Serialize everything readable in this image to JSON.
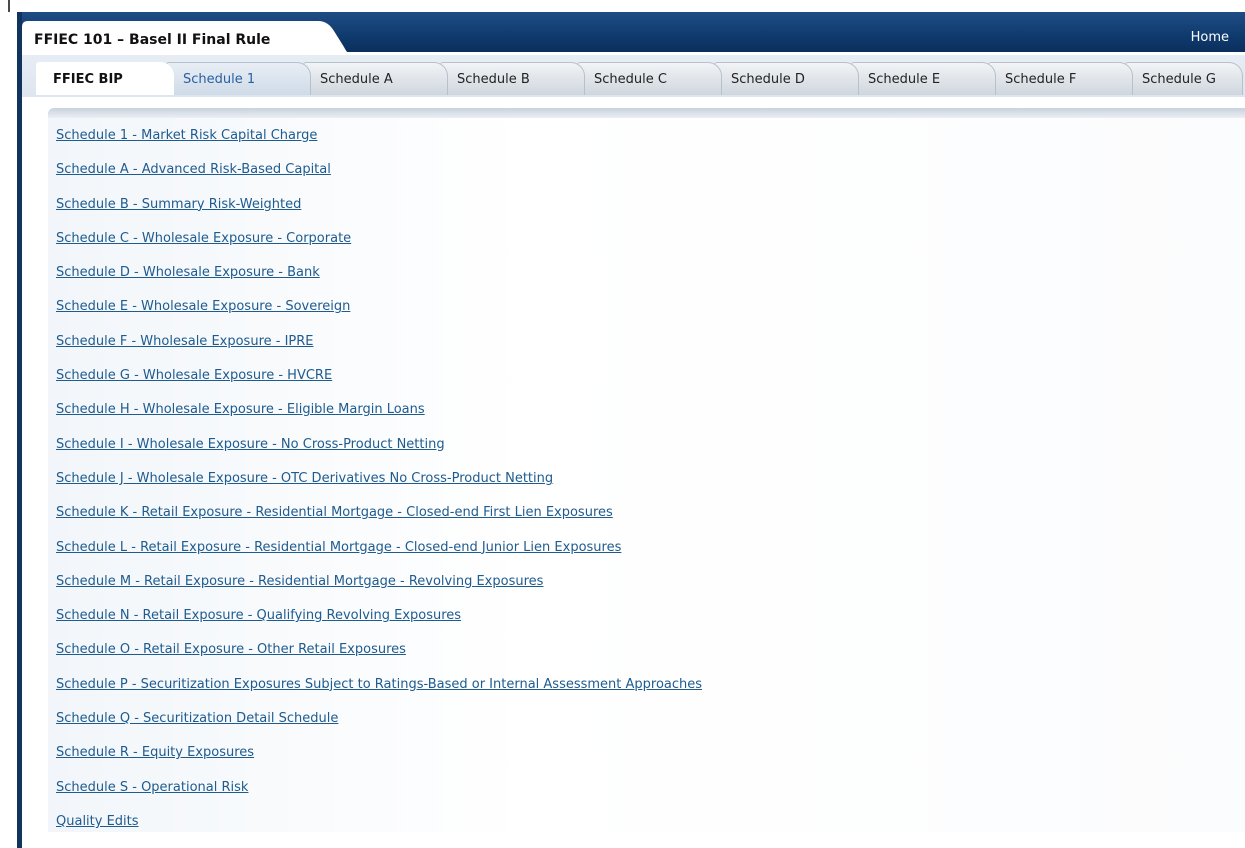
{
  "header": {
    "title": "FFIEC 101 – Basel II Final Rule",
    "home_label": "Home"
  },
  "tabs": [
    {
      "label": "FFIEC BIP",
      "state": "active"
    },
    {
      "label": "Schedule 1",
      "state": "link"
    },
    {
      "label": "Schedule A",
      "state": "normal"
    },
    {
      "label": "Schedule B",
      "state": "normal"
    },
    {
      "label": "Schedule C",
      "state": "normal"
    },
    {
      "label": "Schedule D",
      "state": "normal"
    },
    {
      "label": "Schedule E",
      "state": "normal"
    },
    {
      "label": "Schedule F",
      "state": "normal"
    },
    {
      "label": "Schedule G",
      "state": "normal"
    }
  ],
  "links": [
    "Schedule 1 - Market Risk Capital Charge",
    "Schedule A - Advanced Risk-Based Capital",
    "Schedule B - Summary Risk-Weighted",
    "Schedule C - Wholesale Exposure - Corporate",
    "Schedule D - Wholesale Exposure - Bank",
    "Schedule E - Wholesale Exposure - Sovereign",
    "Schedule F - Wholesale Exposure - IPRE",
    "Schedule G - Wholesale Exposure - HVCRE",
    "Schedule H - Wholesale Exposure - Eligible Margin Loans",
    "Schedule I - Wholesale Exposure - No Cross-Product Netting",
    "Schedule J - Wholesale Exposure - OTC Derivatives No Cross-Product Netting",
    "Schedule K - Retail Exposure - Residential Mortgage - Closed-end First Lien Exposures",
    "Schedule L - Retail Exposure - Residential Mortgage - Closed-end Junior Lien Exposures",
    "Schedule M - Retail Exposure - Residential Mortgage - Revolving Exposures",
    "Schedule N - Retail Exposure - Qualifying Revolving Exposures",
    "Schedule O - Retail Exposure - Other Retail Exposures",
    "Schedule P - Securitization Exposures Subject to Ratings-Based or Internal Assessment Approaches",
    "Schedule Q - Securitization Detail Schedule",
    "Schedule R - Equity Exposures",
    "Schedule S - Operational Risk",
    "Quality Edits"
  ],
  "colors": {
    "header_bg": "#0f3a6d",
    "link": "#1e5b8f",
    "tab_link": "#2a5fa0"
  }
}
